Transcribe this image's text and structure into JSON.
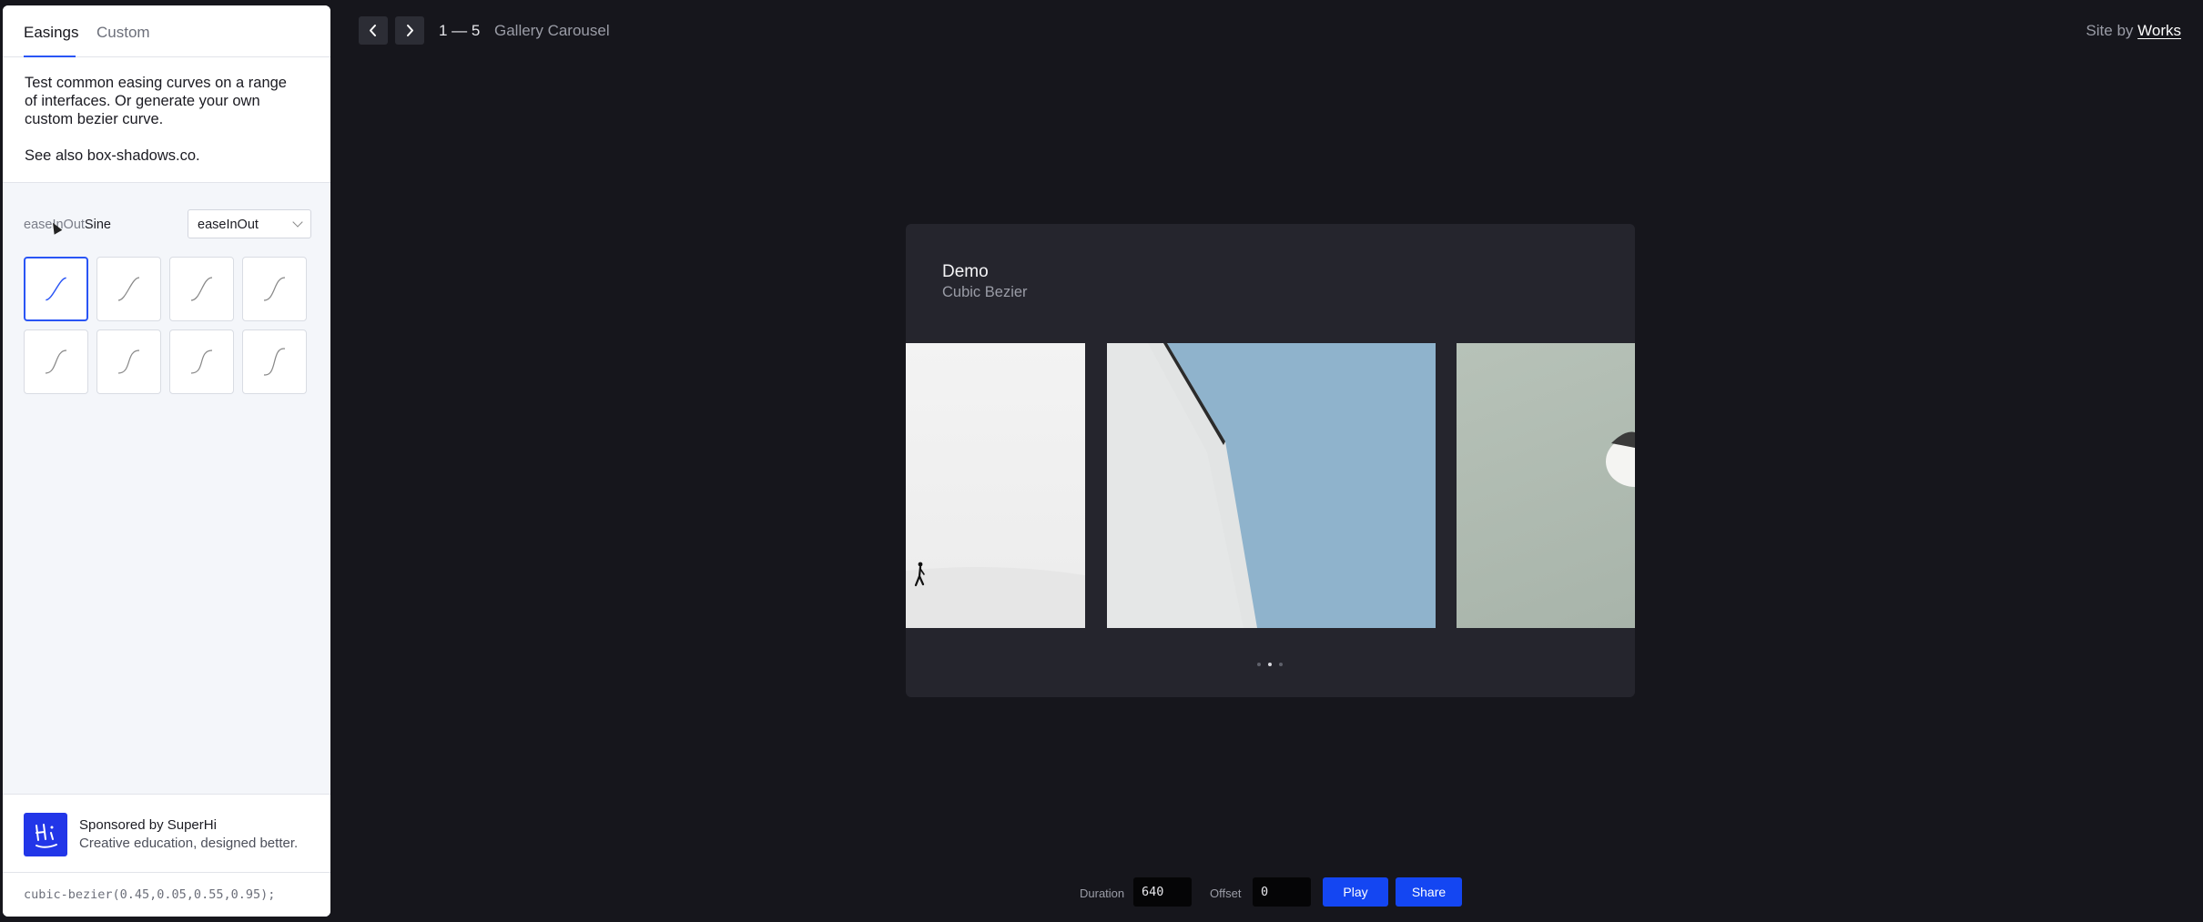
{
  "sidebar": {
    "tabs": [
      {
        "label": "Easings",
        "active": true
      },
      {
        "label": "Custom",
        "active": false
      }
    ],
    "intro": "Test common easing curves on a range of interfaces. Or generate your own custom bezier curve.",
    "see_also": "See also box-shadows.co.",
    "ease_name_prefix": "easeInOut",
    "ease_name_suffix": "Sine",
    "ease_select": "easeInOut",
    "curves_count": 8,
    "selected_curve": 0,
    "sponsor": {
      "title": "Sponsored by SuperHi",
      "subtitle": "Creative education, designed better."
    },
    "code": "cubic-bezier(0.45,0.05,0.55,0.95);"
  },
  "topbar": {
    "pager": "1 — 5",
    "title": "Gallery Carousel",
    "site_by": "Site by",
    "site_link": "Works"
  },
  "demo": {
    "title": "Demo",
    "subtitle": "Cubic Bezier",
    "slides": 3,
    "active_dot": 1
  },
  "controls": {
    "duration_label": "Duration",
    "duration_value": "640",
    "offset_label": "Offset",
    "offset_value": "0",
    "play_label": "Play",
    "share_label": "Share"
  },
  "colors": {
    "accent": "#2a55f5",
    "button": "#1446f2",
    "background": "#16161c",
    "card": "#25252d"
  }
}
